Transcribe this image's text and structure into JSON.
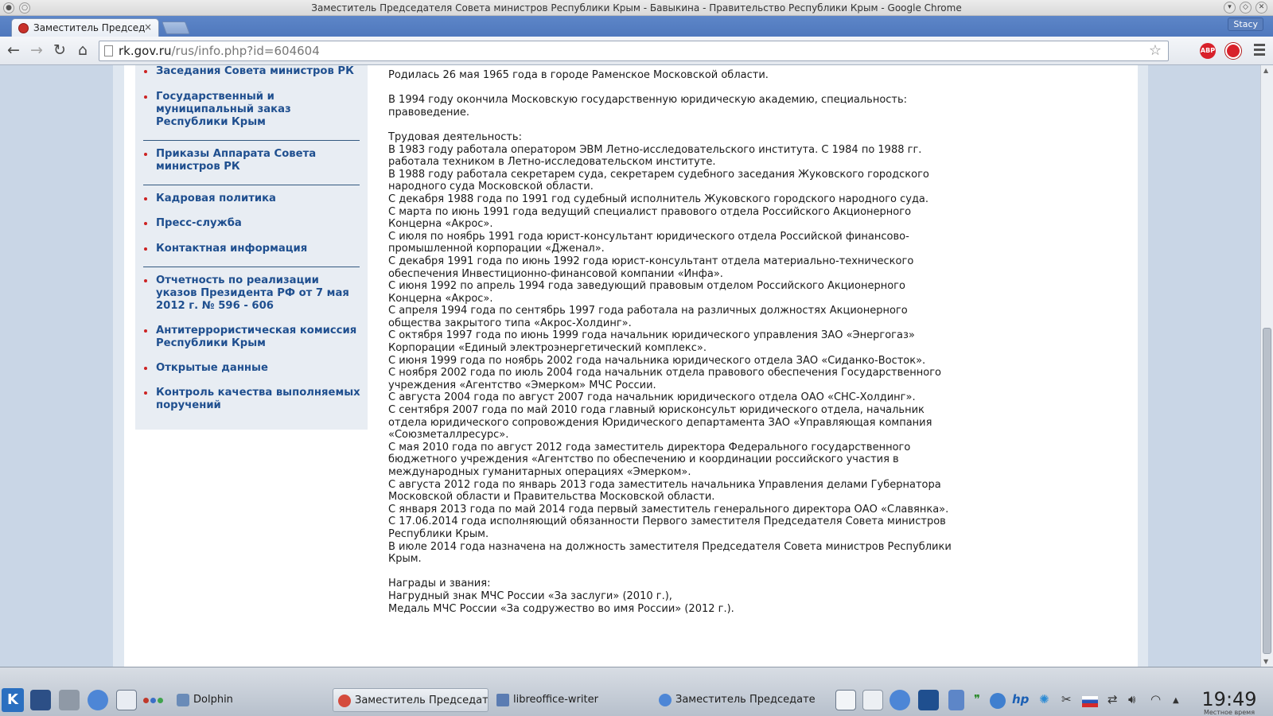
{
  "window": {
    "title": "Заместитель Председателя Совета министров Республики Крым - Бавыкина - Правительство Республики Крым - Google Chrome",
    "user": "Stacy"
  },
  "tab": {
    "label": "Заместитель Председат",
    "close": "×"
  },
  "toolbar": {
    "back": "←",
    "forward": "→",
    "reload": "↻",
    "home": "⌂",
    "url_host": "rk.gov.ru",
    "url_path": "/rus/info.php?id=604604",
    "star": "☆",
    "abp_label": "ABP"
  },
  "sidebar": {
    "items": [
      "Заседания Совета министров РК",
      "Государственный и муниципальный заказ Республики Крым",
      "Приказы Аппарата Совета министров РК",
      "Кадровая политика",
      "Пресс-служба",
      "Контактная информация",
      "Отчетность по реализации указов Президента РФ от 7 мая 2012 г. № 596 - 606",
      "Антитеррористическая комиссия Республики Крым",
      "Открытые данные",
      "Контроль качества выполняемых поручений"
    ]
  },
  "bio": {
    "born": "Родилась 26 мая 1965 года в городе Раменское Московской области.",
    "education": "В 1994 году окончила Московскую государственную юридическую академию, специальность:\nправоведение.",
    "career_heading": "Трудовая деятельность:",
    "career": [
      "В 1983 году работала оператором ЭВМ Летно-исследовательского института. С 1984 по 1988 гг.\nработала техником в Летно-исследовательском институте.",
      "В 1988 году работала секретарем суда, секретарем судебного заседания Жуковского городского\nнародного суда Московской области.",
      "С декабря 1988 года по 1991 год судебный исполнитель Жуковского городского народного суда.",
      "С марта по июнь 1991 года ведущий специалист правового отдела Российского Акционерного\nКонцерна «Акрос».",
      "С июля по ноябрь 1991 года юрист-консультант юридического отдела Российской финансово-\nпромышленной корпорации «Дженал».",
      "С декабря 1991 года по июнь 1992 года юрист-консультант отдела материально-технического\nобеспечения Инвестиционно-финансовой компании «Инфа».",
      "С июня 1992 по апрель 1994 года заведующий правовым отделом Российского Акционерного\nКонцерна «Акрос».",
      "С апреля 1994 года по сентябрь 1997 года работала на различных должностях Акционерного\nобщества закрытого типа «Акрос-Холдинг».",
      "С октября 1997 года по июнь 1999 года начальник юридического управления ЗАО «Энергогаз»\nКорпорации «Единый электроэнергетический комплекс».",
      "С июня 1999 года по ноябрь 2002 года начальника юридического отдела ЗАО «Сиданко-Восток».",
      "С ноября 2002 года по июль 2004 года начальник отдела правового обеспечения Государственного\nучреждения «Агентство «Эмерком» МЧС России.",
      "С августа 2004 года по август 2007 года начальник юридического отдела ОАО «СНС-Холдинг».",
      "С сентября 2007 года по май 2010 года главный юрисконсульт юридического отдела, начальник\nотдела юридического сопровождения Юридического департамента ЗАО «Управляющая компания\n«Союзметаллресурс».",
      "С мая 2010 года по август 2012 года заместитель директора Федерального государственного\nбюджетного учреждения «Агентство по обеспечению и координации российского участия в\nмеждународных гуманитарных операциях «Эмерком».",
      "С августа 2012 года по январь 2013 года заместитель начальника Управления делами Губернатора\nМосковской области и Правительства Московской области.",
      "С января 2013 года по май 2014 года первый заместитель генерального директора ОАО «Славянка».",
      "С 17.06.2014 года исполняющий обязанности Первого заместителя Председателя Совета министров\nРеспублики Крым.",
      "В июле 2014 года назначена на должность заместителя Председателя Совета министров Республики\nКрым."
    ],
    "awards_heading": "Награды и звания:",
    "awards": [
      "Нагрудный знак МЧС России «За заслуги» (2010 г.),",
      "Медаль МЧС России «За содружество во имя России» (2012 г.)."
    ]
  },
  "taskbar": {
    "start": "K",
    "tasks": [
      "Dolphin",
      "Заместитель Председателя С",
      "libreoffice-writer",
      "Заместитель Председателя С"
    ],
    "clock": "19:49",
    "clock_sub": "Местное время"
  },
  "colors": {
    "tabstrip": "#4f78bd",
    "sidebar_link": "#1f4f8f",
    "bullet": "#cc2222",
    "abp": "#d8212a"
  }
}
